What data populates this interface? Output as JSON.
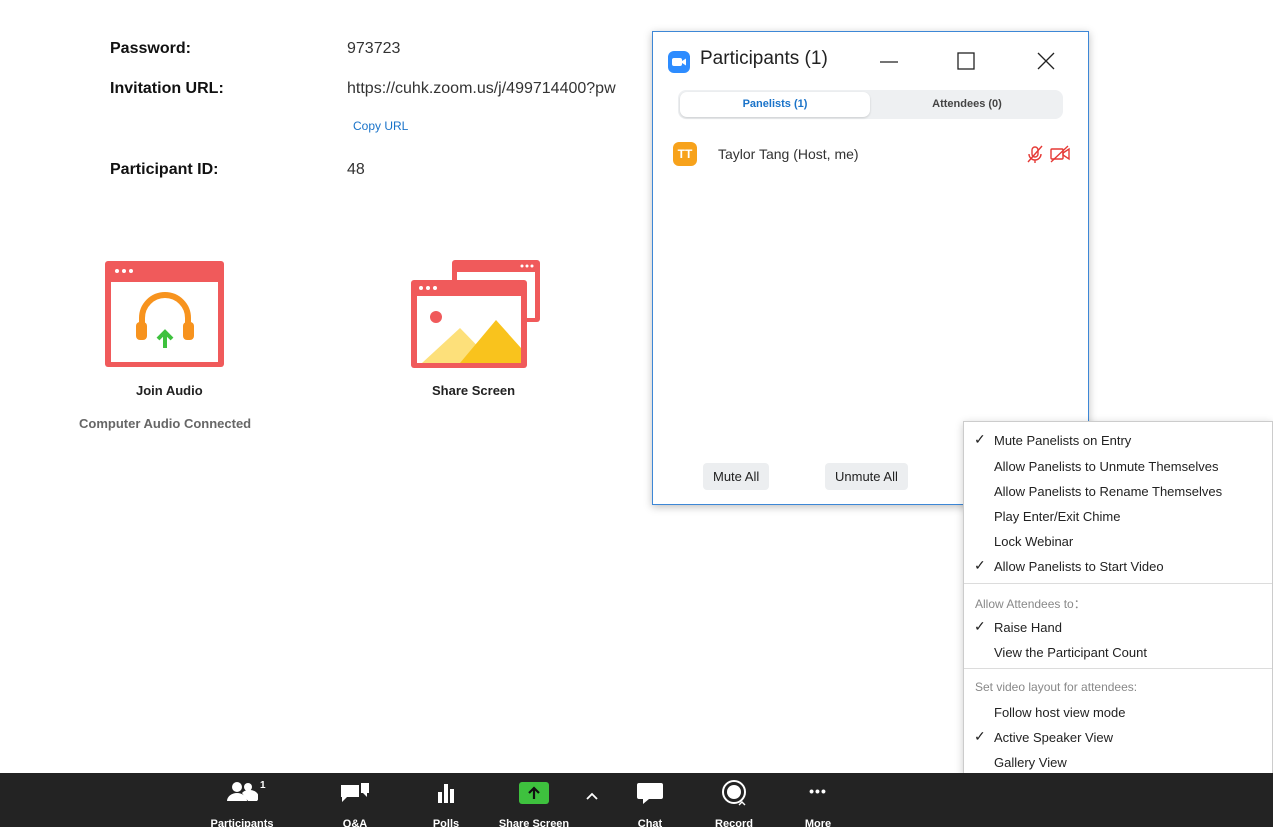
{
  "meeting_info": {
    "cut_text": "",
    "password_label": "Password:",
    "password_value": "973723",
    "invitation_label": "Invitation URL:",
    "invitation_value": "https://cuhk.zoom.us/j/499714400?pw",
    "copy_url": "Copy URL",
    "participant_id_label": "Participant ID:",
    "participant_id_value": "48"
  },
  "tiles": {
    "join_audio": "Join Audio",
    "join_audio_status": "Computer Audio Connected",
    "share_screen": "Share Screen"
  },
  "participants_window": {
    "title": "Participants (1)",
    "tabs": [
      {
        "label": "Panelists (1)",
        "active": true
      },
      {
        "label": "Attendees (0)",
        "active": false
      }
    ],
    "participants": [
      {
        "initials": "TT",
        "name": "Taylor Tang (Host, me)",
        "avatar_color": "#f7a21b",
        "mic_icon": "mic-muted-icon",
        "video_icon": "video-off-icon"
      }
    ],
    "mute_all": "Mute All",
    "unmute_all": "Unmute All"
  },
  "more_menu": {
    "items": [
      {
        "label": "Mute Panelists on Entry",
        "checked": true
      },
      {
        "label": "Allow Panelists to Unmute Themselves",
        "checked": false
      },
      {
        "label": "Allow Panelists to Rename Themselves",
        "checked": false
      },
      {
        "label": "Play Enter/Exit Chime",
        "checked": false
      },
      {
        "label": "Lock Webinar",
        "checked": false
      },
      {
        "label": "Allow Panelists to Start Video",
        "checked": true
      }
    ],
    "attendees_header": "Allow Attendees to：",
    "attendee_items": [
      {
        "label": "Raise Hand",
        "checked": true
      },
      {
        "label": "View the Participant Count",
        "checked": false
      }
    ],
    "layout_header": "Set video layout for attendees:",
    "layout_items": [
      {
        "label": "Follow host view mode",
        "checked": false
      },
      {
        "label": "Active Speaker View",
        "checked": true
      },
      {
        "label": "Gallery View",
        "checked": false
      }
    ],
    "check_glyph": "✓"
  },
  "toolbar": {
    "participants": "Participants",
    "participants_count": "1",
    "qa": "Q&A",
    "polls": "Polls",
    "share_screen": "Share Screen",
    "share_caret": "^",
    "chat": "Chat",
    "record": "Record",
    "more": "More",
    "more_glyph": "•••"
  },
  "colors": {
    "accent": "#1a73c9",
    "zoom_blue": "#2d8cff",
    "tile_red": "#f05a5b",
    "share_green": "#3ec13e",
    "muted_red": "#e53935",
    "toolbar_bg": "#232323"
  }
}
